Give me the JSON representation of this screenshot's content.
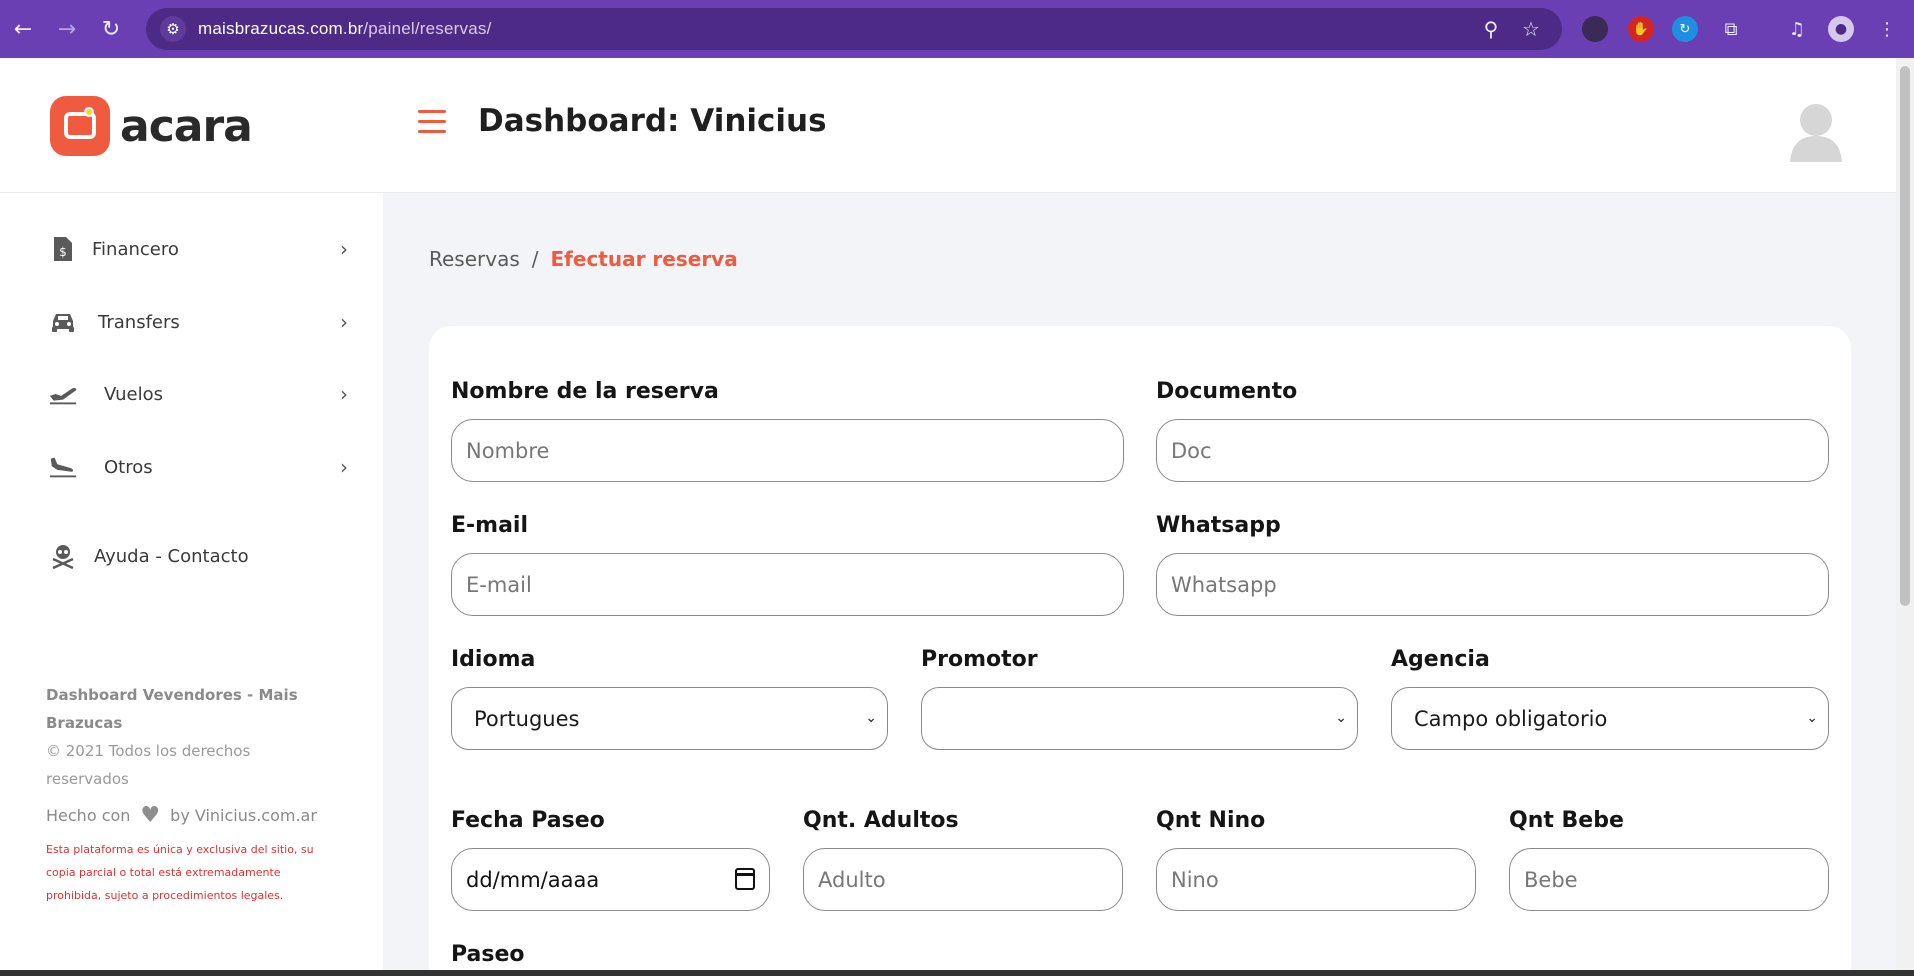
{
  "browser": {
    "url_domain": "maisbrazucas.com.br",
    "url_path": "/painel/reservas/"
  },
  "colors": {
    "accent": "#f05a3e",
    "browser_frame": "#6a3fb3",
    "background": "#f3f4f8",
    "legal_text": "#e03030"
  },
  "header": {
    "logo_text": "acara",
    "title": "Dashboard: Vinicius"
  },
  "sidebar": {
    "items": [
      {
        "label": "Financero",
        "icon": "invoice-icon"
      },
      {
        "label": "Transfers",
        "icon": "car-icon"
      },
      {
        "label": "Vuelos",
        "icon": "plane-takeoff-icon"
      },
      {
        "label": "Otros",
        "icon": "plane-landing-icon"
      }
    ],
    "help_label": "Ayuda - Contacto",
    "footer_title": "Dashboard Vevendores - Mais Brazucas",
    "footer_copyright": "© 2021 Todos los derechos reservados",
    "made_with_prefix": "Hecho con",
    "made_with_suffix": "by Vinicius.com.ar",
    "legal_notice": "Esta plataforma es única y exclusiva del sitio, su copia parcial o total está extremadamente prohibida, sujeto a procedimientos legales."
  },
  "breadcrumb": {
    "parent": "Reservas",
    "separator": "/",
    "current": "Efectuar reserva"
  },
  "form": {
    "nombre": {
      "label": "Nombre de la reserva",
      "placeholder": "Nombre"
    },
    "documento": {
      "label": "Documento",
      "placeholder": "Doc"
    },
    "email": {
      "label": "E-mail",
      "placeholder": "E-mail"
    },
    "whatsapp": {
      "label": "Whatsapp",
      "placeholder": "Whatsapp"
    },
    "idioma": {
      "label": "Idioma",
      "value": "Portugues"
    },
    "promotor": {
      "label": "Promotor",
      "value": ""
    },
    "agencia": {
      "label": "Agencia",
      "value": "Campo obligatorio"
    },
    "fecha": {
      "label": "Fecha Paseo",
      "value": "dd/mm/aaaa"
    },
    "adultos": {
      "label": "Qnt. Adultos",
      "placeholder": "Adulto"
    },
    "nino": {
      "label": "Qnt Nino",
      "placeholder": "Nino"
    },
    "bebe": {
      "label": "Qnt Bebe",
      "placeholder": "Bebe"
    },
    "paseo": {
      "label": "Paseo"
    }
  }
}
